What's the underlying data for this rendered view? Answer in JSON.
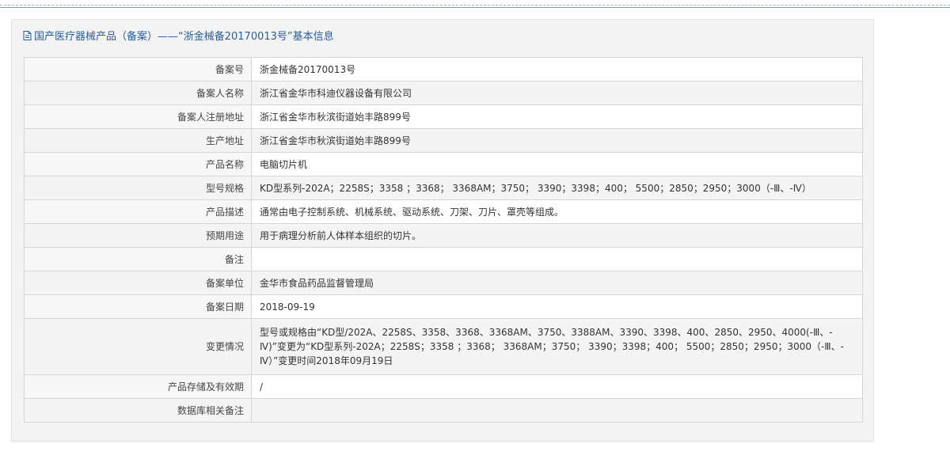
{
  "header": {
    "title": "国产医疗器械产品（备案）——“浙金械备20170013号”基本信息"
  },
  "rows": [
    {
      "label": "备案号",
      "value": "浙金械备20170013号"
    },
    {
      "label": "备案人名称",
      "value": "浙江省金华市科迪仪器设备有限公司"
    },
    {
      "label": "备案人注册地址",
      "value": "浙江省金华市秋滨街道始丰路899号"
    },
    {
      "label": "生产地址",
      "value": "浙江省金华市秋滨街道始丰路899号"
    },
    {
      "label": "产品名称",
      "value": "电脑切片机"
    },
    {
      "label": "型号规格",
      "value": "KD型系列-202A；2258S；3358 ；3368；  3368AM；3750； 3390；3398；400； 5500；2850；2950；3000（-Ⅲ、-Ⅳ）"
    },
    {
      "label": "产品描述",
      "value": "通常由电子控制系统、机械系统、驱动系统、刀架、刀片、罩壳等组成。"
    },
    {
      "label": "预期用途",
      "value": "用于病理分析前人体样本组织的切片。"
    },
    {
      "label": "备注",
      "value": ""
    },
    {
      "label": "备案单位",
      "value": "金华市食品药品监督管理局"
    },
    {
      "label": "备案日期",
      "value": "2018-09-19"
    },
    {
      "label": "变更情况",
      "value": "型号或规格由“KD型/202A、2258S、3358、3368、3368AM、3750、3388AM、3390、3398、400、2850、2950、4000(-Ⅲ、-Ⅳ)”变更为“KD型系列-202A；2258S；3358 ；3368； 3368AM；3750； 3390；3398；400； 5500；2850；2950；3000（-Ⅲ、-Ⅳ）”变更时间2018年09月19日"
    },
    {
      "label": "产品存储及有效期",
      "value": "/"
    },
    {
      "label": "数据库相关备注",
      "value": ""
    }
  ]
}
